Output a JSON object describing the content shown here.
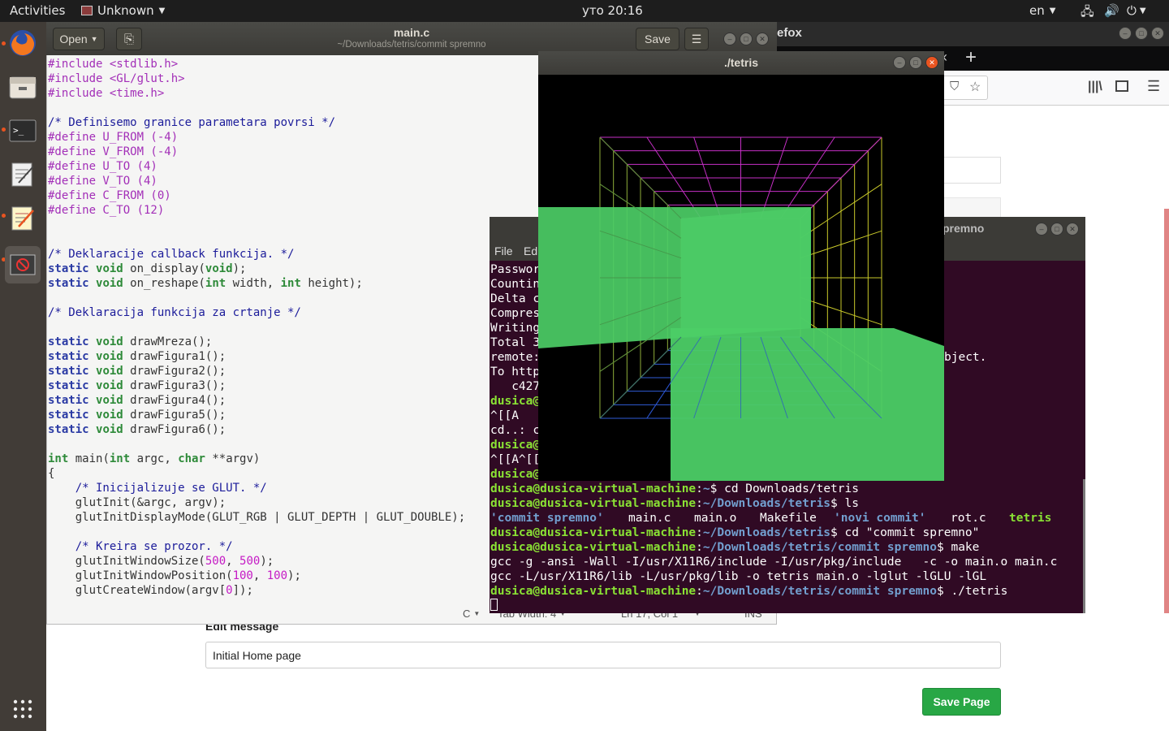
{
  "topbar": {
    "activities": "Activities",
    "app_name": "Unknown",
    "clock": "уто 20:16",
    "language": "en"
  },
  "dock": {
    "items": [
      "firefox-icon",
      "files-icon",
      "terminal-icon",
      "text-editor-icon",
      "gedit-icon",
      "unknown-app-icon"
    ],
    "show_apps_icon": "grid-icon"
  },
  "firefox": {
    "title_fragment": "efox",
    "edit_message_label": "Edit message",
    "message_value": "Initial Home page",
    "save_button": "Save Page"
  },
  "gedit": {
    "open_label": "Open",
    "title": "main.c",
    "subtitle": "~/Downloads/tetris/commit spremno",
    "save_label": "Save",
    "status": {
      "language": "C",
      "tab_width": "Tab Width: 4",
      "cursor": "Ln 17, Col 1",
      "mode": "INS"
    }
  },
  "terminal": {
    "title_fragment": "premno",
    "menu": [
      "File",
      "Ed"
    ],
    "partial_lines": [
      "Passwor",
      "Countin",
      "Delta c",
      "Compres",
      "Writing",
      "Total 3",
      "remote:",
      "To http",
      "   c427"
    ],
    "object_text": "bject.",
    "prompt_user": "dusica@dusica-virtual-machine",
    "lines": [
      {
        "path": "~",
        "cmd": "$ cd Downloads/tetris"
      },
      {
        "path": "~/Downloads/tetris",
        "cmd": "$ ls"
      },
      {
        "path": "~/Downloads/tetris",
        "cmd": "$ cd \"commit spremno\""
      },
      {
        "path": "~/Downloads/tetris/commit spremno",
        "cmd": "$ make"
      },
      {
        "path": "~/Downloads/tetris/commit spremno",
        "cmd": "$ ./tetris"
      }
    ],
    "ls_output": [
      "'commit spremno'",
      "main.c",
      "main.o",
      "Makefile",
      "'novi commit'",
      "rot.c",
      "tetris"
    ],
    "gcc1": "gcc -g -ansi -Wall -I/usr/X11R6/include -I/usr/pkg/include   -c -o main.o main.c",
    "gcc2": "gcc -L/usr/X11R6/lib -L/usr/pkg/lib -o tetris main.o -lglut -lGLU -lGL",
    "partial_misc": [
      "^[[A",
      "cd..: c",
      "^[[A^[["
    ],
    "partial_user": "dusica@"
  },
  "tetris": {
    "title": "./tetris"
  },
  "colors": {
    "terminal_bg": "#300a24",
    "accent": "#e95420",
    "green_block": "#4ccd66",
    "save_green": "#28a745"
  }
}
